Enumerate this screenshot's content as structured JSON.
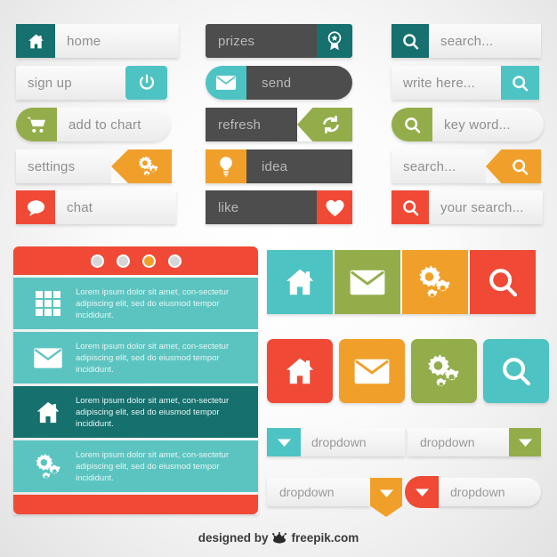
{
  "colors": {
    "dark_teal": "#15706e",
    "teal": "#4ec3c3",
    "green": "#94ad4b",
    "orange": "#f0a02a",
    "red": "#f04a36",
    "charcoal": "#4d4d4d",
    "light": "#f3f3f3",
    "text_grey": "#8e8e8e"
  },
  "buttons_left": [
    {
      "label": "home",
      "icon": "home-icon",
      "icon_color": "#15706e",
      "icon_side": "left"
    },
    {
      "label": "sign up",
      "icon": "power-icon",
      "icon_color": "#4ec3c3",
      "icon_side": "right"
    },
    {
      "label": "add to chart",
      "icon": "cart-icon",
      "icon_color": "#94ad4b",
      "icon_side": "left"
    },
    {
      "label": "settings",
      "icon": "gears-icon",
      "icon_color": "#f0a02a",
      "icon_side": "right"
    },
    {
      "label": "chat",
      "icon": "chat-icon",
      "icon_color": "#f04a36",
      "icon_side": "left"
    }
  ],
  "buttons_middle": [
    {
      "label": "prizes",
      "icon": "award-icon",
      "icon_color": "#15706e",
      "icon_side": "right"
    },
    {
      "label": "send",
      "icon": "mail-icon",
      "icon_color": "#4ec3c3",
      "icon_side": "left"
    },
    {
      "label": "refresh",
      "icon": "refresh-icon",
      "icon_color": "#94ad4b",
      "icon_side": "right"
    },
    {
      "label": "idea",
      "icon": "bulb-icon",
      "icon_color": "#f0a02a",
      "icon_side": "left"
    },
    {
      "label": "like",
      "icon": "heart-icon",
      "icon_color": "#f04a36",
      "icon_side": "right"
    }
  ],
  "search_fields": [
    {
      "placeholder": "search...",
      "icon": "search-icon",
      "icon_color": "#15706e",
      "icon_side": "left"
    },
    {
      "placeholder": "write here...",
      "icon": "search-icon",
      "icon_color": "#4ec3c3",
      "icon_side": "right"
    },
    {
      "placeholder": "key word...",
      "icon": "search-icon",
      "icon_color": "#94ad4b",
      "icon_side": "left"
    },
    {
      "placeholder": "search...",
      "icon": "search-icon",
      "icon_color": "#f0a02a",
      "icon_side": "right"
    },
    {
      "placeholder": "your search...",
      "icon": "search-icon",
      "icon_color": "#f04a36",
      "icon_side": "left"
    }
  ],
  "panel": {
    "header_color": "#f04a36",
    "footer_color": "#f04a36",
    "dots": [
      {
        "active": false,
        "color": "#d6d6d6"
      },
      {
        "active": false,
        "color": "#d6d6d6"
      },
      {
        "active": true,
        "color": "#f0a02a"
      },
      {
        "active": false,
        "color": "#d6d6d6"
      }
    ],
    "rows": [
      {
        "icon": "grid-icon",
        "bg": "#5bc4c0",
        "text": "Lorem ipsum dolor sit amet, con-sectetur adipiscing elit, sed do eiusmod tempor incididunt."
      },
      {
        "icon": "mail-icon",
        "bg": "#5bc4c0",
        "text": "Lorem ipsum dolor sit amet, con-sectetur adipiscing elit, sed do eiusmod tempor incididunt."
      },
      {
        "icon": "home-icon",
        "bg": "#15706e",
        "text": "Lorem ipsum dolor sit amet, con-sectetur adipiscing elit, sed do eiusmod tempor incididunt."
      },
      {
        "icon": "gears-icon",
        "bg": "#5bc4c0",
        "text": "Lorem ipsum dolor sit amet, con-sectetur adipiscing elit, sed do eiusmod tempor incididunt."
      }
    ]
  },
  "tiles_row_square": [
    {
      "icon": "home-icon",
      "bg": "#4ec3c3"
    },
    {
      "icon": "mail-icon",
      "bg": "#94ad4b"
    },
    {
      "icon": "gears-icon",
      "bg": "#f0a02a"
    },
    {
      "icon": "search-icon",
      "bg": "#f04a36"
    }
  ],
  "tiles_row_rounded": [
    {
      "icon": "home-icon",
      "bg": "#f04a36"
    },
    {
      "icon": "mail-icon",
      "bg": "#f0a02a"
    },
    {
      "icon": "gears-icon",
      "bg": "#94ad4b"
    },
    {
      "icon": "search-icon",
      "bg": "#4ec3c3"
    }
  ],
  "dropdowns": [
    {
      "label": "dropdown",
      "color": "#4ec3c3",
      "caret_side": "left",
      "shape": "square"
    },
    {
      "label": "dropdown",
      "color": "#94ad4b",
      "caret_side": "right",
      "shape": "square"
    },
    {
      "label": "dropdown",
      "color": "#f0a02a",
      "caret_side": "right",
      "shape": "pin"
    },
    {
      "label": "dropdown",
      "color": "#f04a36",
      "caret_side": "left",
      "shape": "circle"
    }
  ],
  "footer": {
    "prefix": "designed by",
    "brand": "freepik.com",
    "logo": "freepik-crown-icon"
  }
}
